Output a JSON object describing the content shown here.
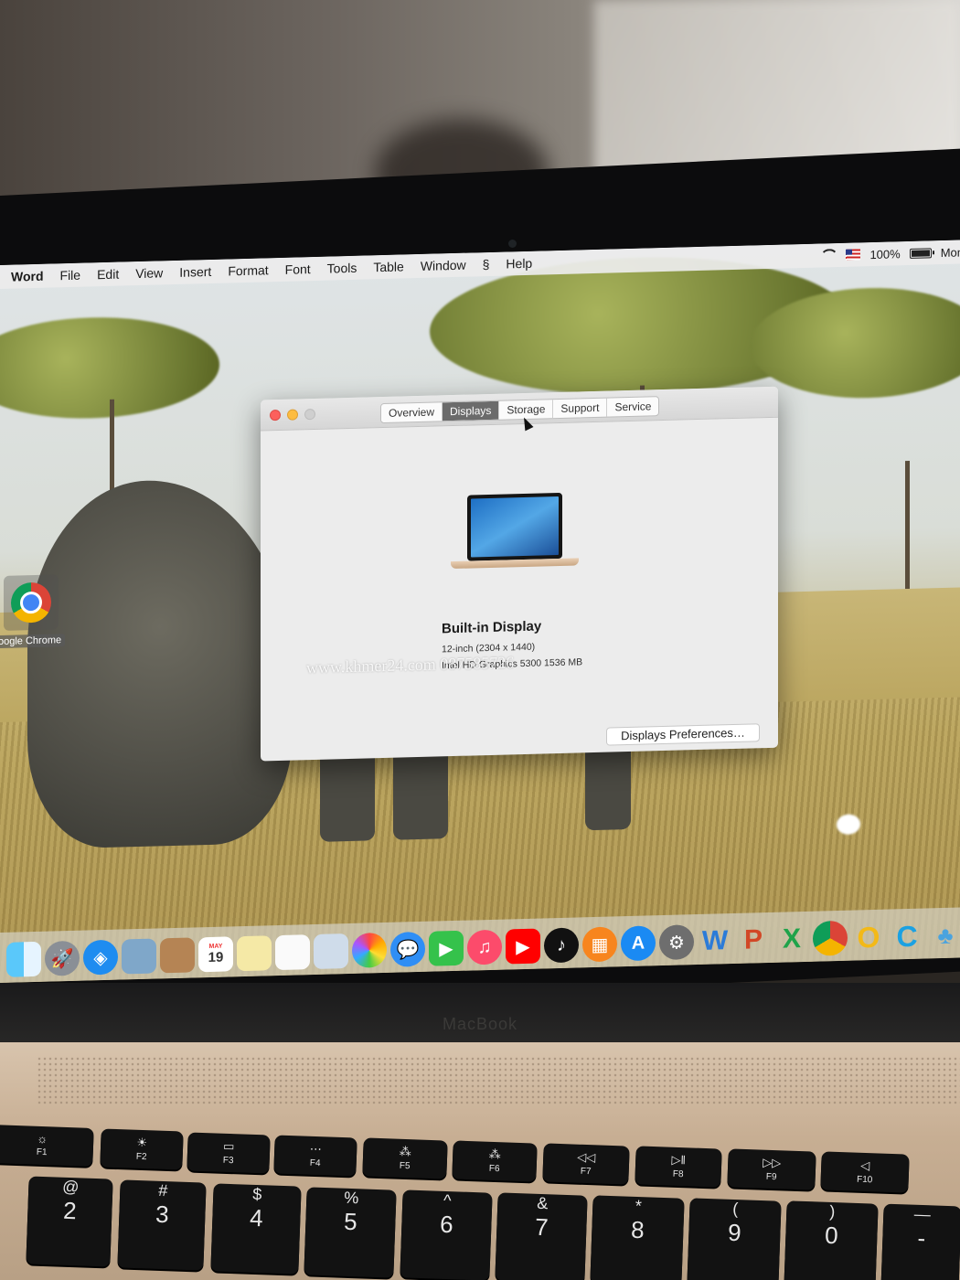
{
  "menubar": {
    "items": [
      "Word",
      "File",
      "Edit",
      "View",
      "Insert",
      "Format",
      "Font",
      "Tools",
      "Table",
      "Window",
      "Help"
    ],
    "script_icon": "script-icon",
    "battery": "100%",
    "clock": "Mon"
  },
  "desktop": {
    "chrome_label": "oogle Chrome"
  },
  "window": {
    "tabs": [
      "Overview",
      "Displays",
      "Storage",
      "Support",
      "Service"
    ],
    "active_tab": "Displays",
    "display_title": "Built-in Display",
    "display_size": "12-inch (2304 x 1440)",
    "graphics": "Intel HD Graphics 5300 1536 MB",
    "prefs_button": "Displays Preferences…",
    "watermark": "www.khmer24.com  087585726"
  },
  "dock": {
    "items": [
      "finder",
      "launchpad",
      "safari",
      "preview",
      "contacts",
      "calendar",
      "notes",
      "reminders",
      "preview-2",
      "photos",
      "messages",
      "facetime",
      "music",
      "youtube",
      "tiktok",
      "books",
      "app-store",
      "system-preferences",
      "word",
      "powerpoint",
      "excel",
      "chrome",
      "opera",
      "c-app",
      "people",
      "globe"
    ],
    "calendar_day": "19",
    "calendar_month": "MAY"
  },
  "laptop": {
    "brand": "MacBook",
    "fkeys": [
      {
        "label": "F1",
        "icon": "brightness-down-icon"
      },
      {
        "label": "F2",
        "icon": "brightness-up-icon"
      },
      {
        "label": "F3",
        "icon": "mission-control-icon"
      },
      {
        "label": "F4",
        "icon": "launchpad-icon"
      },
      {
        "label": "F5",
        "icon": "keyboard-light-down-icon"
      },
      {
        "label": "F6",
        "icon": "keyboard-light-up-icon"
      },
      {
        "label": "F7",
        "icon": "rewind-icon"
      },
      {
        "label": "F8",
        "icon": "play-pause-icon"
      },
      {
        "label": "F9",
        "icon": "fast-forward-icon"
      },
      {
        "label": "F10",
        "icon": "mute-icon"
      }
    ],
    "number_keys": [
      {
        "top": "@",
        "bot": "2"
      },
      {
        "top": "#",
        "bot": "3"
      },
      {
        "top": "$",
        "bot": "4"
      },
      {
        "top": "%",
        "bot": "5"
      },
      {
        "top": "^",
        "bot": "6"
      },
      {
        "top": "&",
        "bot": "7"
      },
      {
        "top": "*",
        "bot": "8"
      },
      {
        "top": "(",
        "bot": "9"
      },
      {
        "top": ")",
        "bot": "0"
      },
      {
        "top": "—",
        "bot": "-"
      }
    ]
  }
}
